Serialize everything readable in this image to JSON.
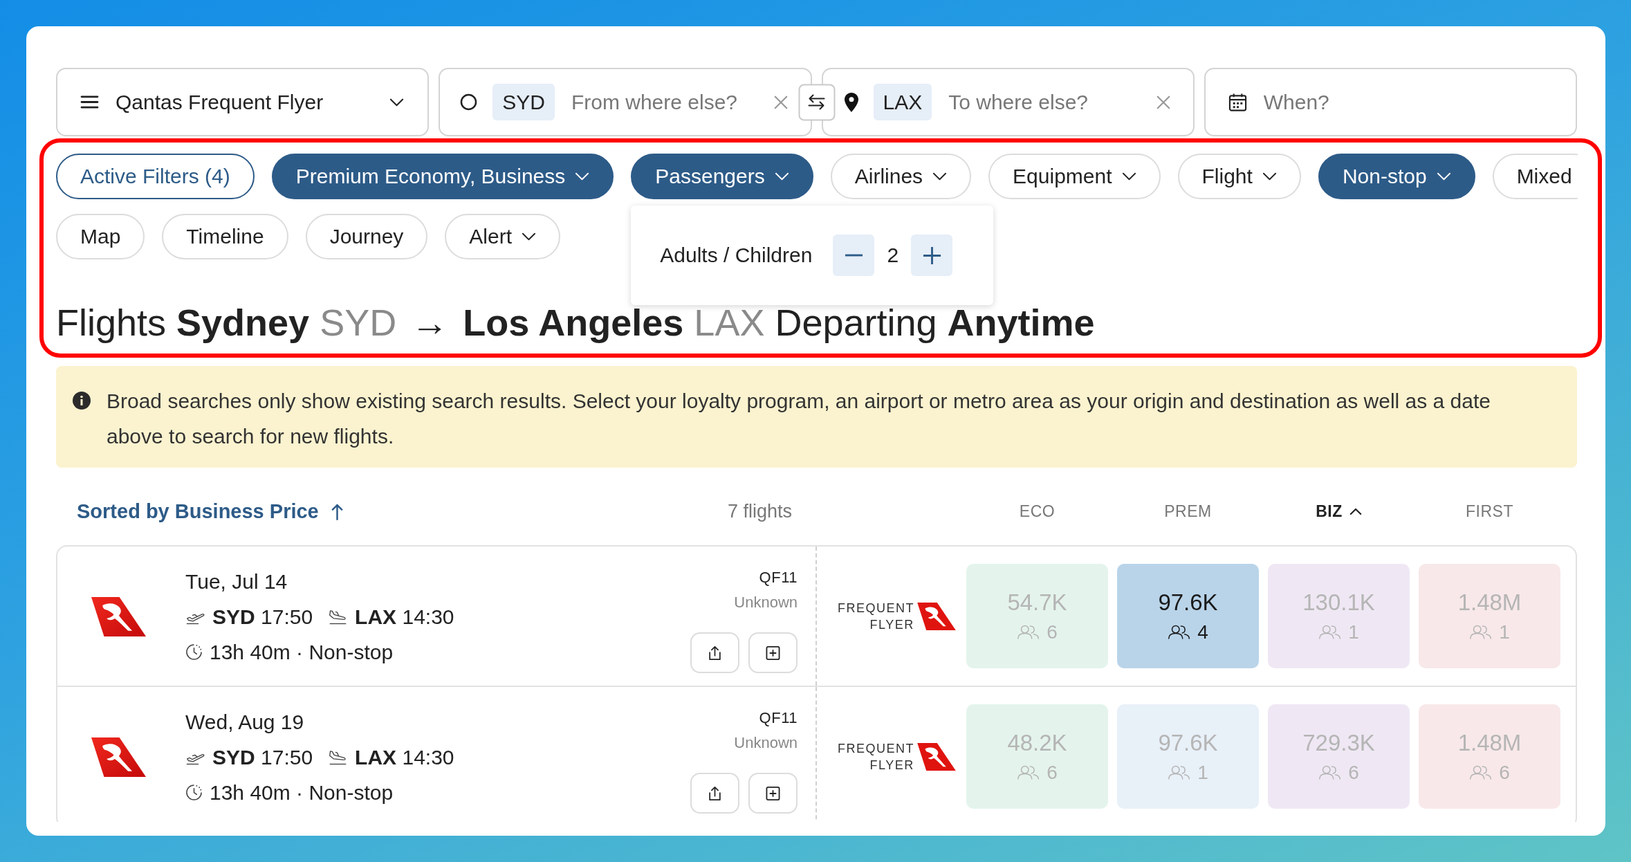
{
  "search_bar": {
    "program": {
      "value": "Qantas Frequent Flyer"
    },
    "origin": {
      "code": "SYD",
      "placeholder": "From where else?"
    },
    "destination": {
      "code": "LAX",
      "placeholder": "To where else?"
    },
    "date": {
      "placeholder": "When?"
    }
  },
  "filters": [
    {
      "label": "Active Filters (4)",
      "kind": "summary",
      "active": false,
      "caret": false
    },
    {
      "label": "Premium Economy, Business",
      "kind": "filter",
      "active": true,
      "caret": true
    },
    {
      "label": "Passengers",
      "kind": "filter",
      "active": true,
      "caret": true,
      "expanded": true,
      "menu": {
        "label": "Adults / Children",
        "value": "2"
      }
    },
    {
      "label": "Airlines",
      "kind": "filter",
      "active": false,
      "caret": true
    },
    {
      "label": "Equipment",
      "kind": "filter",
      "active": false,
      "caret": true
    },
    {
      "label": "Flight",
      "kind": "filter",
      "active": false,
      "caret": true
    },
    {
      "label": "Non-stop",
      "kind": "filter",
      "active": true,
      "caret": true
    },
    {
      "label": "Mixed",
      "kind": "filter",
      "active": false,
      "caret": false
    }
  ],
  "view_options": [
    {
      "label": "Map",
      "caret": false
    },
    {
      "label": "Timeline",
      "caret": false
    },
    {
      "label": "Journey",
      "caret": false
    },
    {
      "label": "Alert",
      "caret": true
    }
  ],
  "title": [
    {
      "text": "Flights",
      "kind": "plain"
    },
    {
      "text": "Sydney",
      "kind": "bold"
    },
    {
      "text": "SYD",
      "kind": "muted"
    },
    {
      "text": "→",
      "kind": "arrow"
    },
    {
      "text": "Los Angeles",
      "kind": "bold"
    },
    {
      "text": "LAX",
      "kind": "muted"
    },
    {
      "text": "Departing",
      "kind": "plain"
    },
    {
      "text": "Anytime",
      "kind": "bold"
    }
  ],
  "notice": {
    "text": "Broad searches only show existing search results. Select your loyalty program, an airport or metro area as your origin and destination as well as a date above to search for new flights."
  },
  "results_header": {
    "sort_label": "Sorted by Business Price",
    "count": "7 flights",
    "columns": [
      {
        "label": "ECO",
        "selected": false
      },
      {
        "label": "PREM",
        "selected": false
      },
      {
        "label": "BIZ",
        "selected": true
      },
      {
        "label": "FIRST",
        "selected": false
      }
    ]
  },
  "flights": [
    {
      "date": "Tue, Jul 14",
      "departure": "**SYD** 17:50",
      "arrival": "**LAX** 14:30",
      "duration": "13h 40m · Non-stop",
      "flight_number": "QF11",
      "aircraft": "Unknown",
      "program_logo": "FREQUENT FLYER",
      "prices": [
        {
          "price": "54.7K",
          "seats": "6",
          "color": "#e4f4ec",
          "highlighted": false
        },
        {
          "price": "97.6K",
          "seats": "4",
          "color": "#b9d4e9",
          "highlighted": true
        },
        {
          "price": "130.1K",
          "seats": "1",
          "color": "#efe8f4",
          "highlighted": false
        },
        {
          "price": "1.48M",
          "seats": "1",
          "color": "#f8e8e9",
          "highlighted": false
        }
      ]
    },
    {
      "date": "Wed, Aug 19",
      "departure": "**SYD** 17:50",
      "arrival": "**LAX** 14:30",
      "duration": "13h 40m · Non-stop",
      "flight_number": "QF11",
      "aircraft": "Unknown",
      "program_logo": "FREQUENT FLYER",
      "prices": [
        {
          "price": "48.2K",
          "seats": "6",
          "color": "#e4f4ec",
          "highlighted": false
        },
        {
          "price": "97.6K",
          "seats": "1",
          "color": "#e8f0f8",
          "highlighted": false
        },
        {
          "price": "729.3K",
          "seats": "6",
          "color": "#efe8f4",
          "highlighted": false
        },
        {
          "price": "1.48M",
          "seats": "6",
          "color": "#f8e8e9",
          "highlighted": false
        }
      ]
    }
  ]
}
